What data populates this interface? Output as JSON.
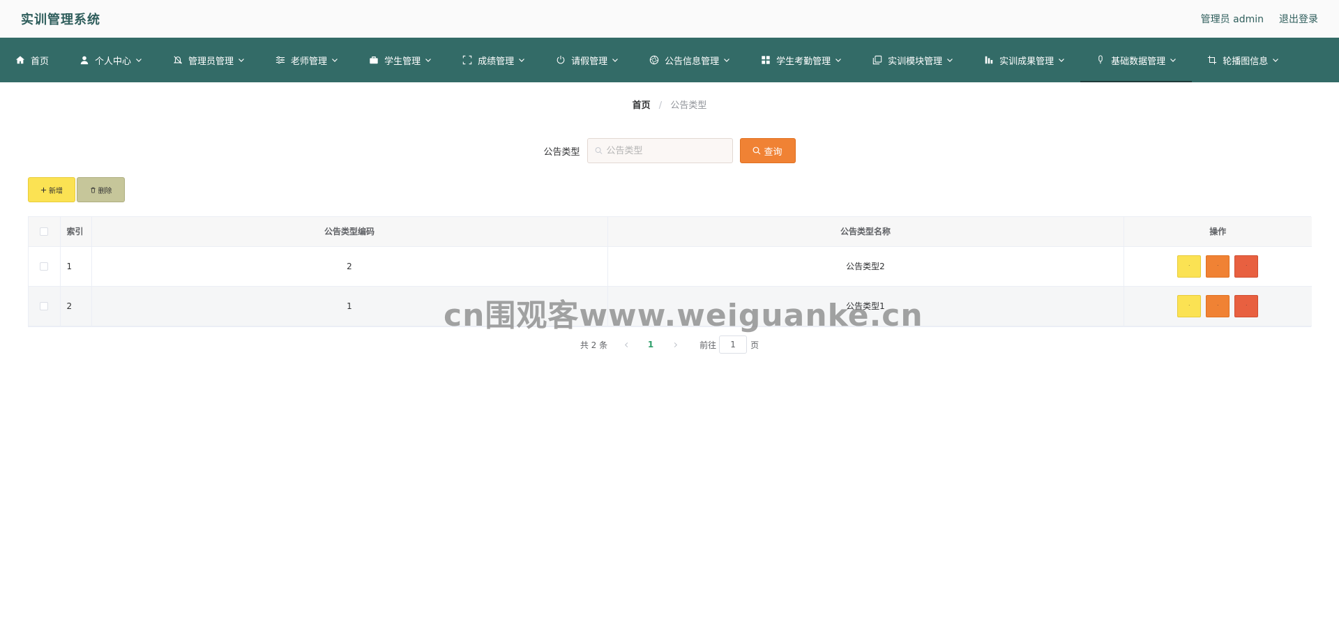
{
  "header": {
    "title": "实训管理系统",
    "user_label": "管理员 admin",
    "logout_label": "退出登录"
  },
  "nav": {
    "items": [
      {
        "label": "首页",
        "icon": "home-icon",
        "has_dropdown": false
      },
      {
        "label": "个人中心",
        "icon": "user-icon",
        "has_dropdown": true
      },
      {
        "label": "管理员管理",
        "icon": "bell-off-icon",
        "has_dropdown": true
      },
      {
        "label": "老师管理",
        "icon": "sliders-icon",
        "has_dropdown": true
      },
      {
        "label": "学生管理",
        "icon": "briefcase-icon",
        "has_dropdown": true
      },
      {
        "label": "成绩管理",
        "icon": "fullscreen-icon",
        "has_dropdown": true
      },
      {
        "label": "请假管理",
        "icon": "power-icon",
        "has_dropdown": true
      },
      {
        "label": "公告信息管理",
        "icon": "aperture-icon",
        "has_dropdown": true
      },
      {
        "label": "学生考勤管理",
        "icon": "grid-icon",
        "has_dropdown": true
      },
      {
        "label": "实训模块管理",
        "icon": "copy-icon",
        "has_dropdown": true
      },
      {
        "label": "实训成果管理",
        "icon": "chart-icon",
        "has_dropdown": true
      },
      {
        "label": "基础数据管理",
        "icon": "microphone-icon",
        "has_dropdown": true
      },
      {
        "label": "轮播图信息",
        "icon": "crop-icon",
        "has_dropdown": true
      }
    ],
    "active_index": 11
  },
  "breadcrumb": {
    "home": "首页",
    "separator": "/",
    "current": "公告类型"
  },
  "search": {
    "label": "公告类型",
    "placeholder": "公告类型",
    "value": "",
    "button_label": "查询"
  },
  "actions": {
    "add_label": "新增",
    "delete_label": "删除"
  },
  "table": {
    "columns": [
      "索引",
      "公告类型编码",
      "公告类型名称",
      "操作"
    ],
    "rows": [
      {
        "index": "1",
        "code": "2",
        "name": "公告类型2"
      },
      {
        "index": "2",
        "code": "1",
        "name": "公告类型1"
      }
    ],
    "op_button_text": "·"
  },
  "pagination": {
    "total_text": "共 2 条",
    "current_page": "1",
    "goto_label": "前往",
    "goto_value": "1",
    "page_suffix": "页"
  },
  "watermark": "cn围观客www.weiguanke.cn",
  "colors": {
    "nav_bg": "#336b67",
    "title": "#2f5e5c",
    "query_button": "#f08234",
    "add_button": "#fbe253",
    "delete_button": "#c6c69a",
    "op_yellow": "#fbe253",
    "op_orange": "#f08234",
    "op_red": "#e86040",
    "active_page": "#2e9e6a"
  }
}
